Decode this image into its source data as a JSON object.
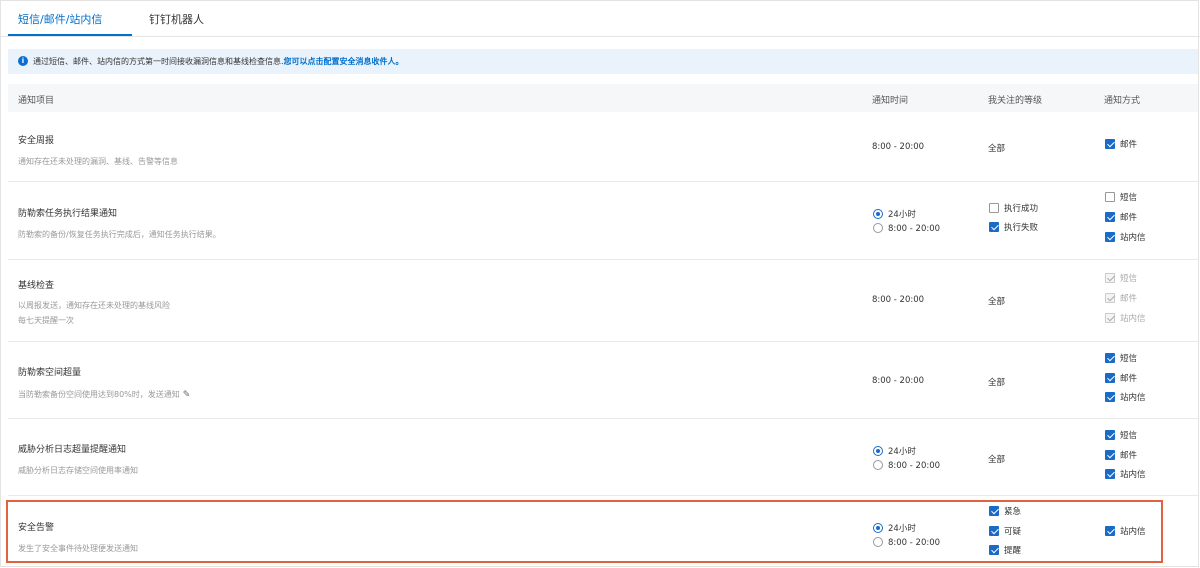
{
  "tabs": [
    {
      "label": "短信/邮件/站内信",
      "active": true
    },
    {
      "label": "钉钉机器人",
      "active": false
    }
  ],
  "info": {
    "icon": "info-icon",
    "text": "通过短信、邮件、站内信的方式第一时间接收漏洞信息和基线检查信息.",
    "link": "您可以点击配置安全消息收件人。"
  },
  "table": {
    "headers": [
      "通知项目",
      "通知时间",
      "我关注的等级",
      "通知方式"
    ],
    "rows": [
      {
        "title": "安全周报",
        "desc": "通知存在还未处理的漏洞、基线、告警等信息",
        "time": "8:00 - 20:00",
        "level": "全部",
        "methods": [
          {
            "label": "邮件",
            "checked": true
          }
        ]
      },
      {
        "title": "防勒索任务执行结果通知",
        "desc": "防勒索的备份/恢复任务执行完成后，通知任务执行结果。",
        "time_options": [
          {
            "label": "24小时",
            "selected": true
          },
          {
            "label": "8:00 - 20:00",
            "selected": false
          }
        ],
        "level_options": [
          {
            "label": "执行成功",
            "checked": false
          },
          {
            "label": "执行失败",
            "checked": true
          }
        ],
        "methods": [
          {
            "label": "短信",
            "checked": false
          },
          {
            "label": "邮件",
            "checked": true
          },
          {
            "label": "站内信",
            "checked": true
          }
        ]
      },
      {
        "title": "基线检查",
        "desc": "以周报发送，通知存在还未处理的基线风险",
        "desc2": "每七天提醒一次",
        "time": "8:00 - 20:00",
        "level": "全部",
        "methods": [
          {
            "label": "短信",
            "checked": true,
            "disabled": true
          },
          {
            "label": "邮件",
            "checked": true,
            "disabled": true
          },
          {
            "label": "站内信",
            "checked": true,
            "disabled": true
          }
        ]
      },
      {
        "title": "防勒索空间超量",
        "desc": "当防勒索备份空间使用达到80%时，发送通知",
        "edit_icon": "edit-icon",
        "time": "8:00 - 20:00",
        "level": "全部",
        "methods": [
          {
            "label": "短信",
            "checked": true
          },
          {
            "label": "邮件",
            "checked": true
          },
          {
            "label": "站内信",
            "checked": true
          }
        ]
      },
      {
        "title": "威胁分析日志超量提醒通知",
        "desc": "威胁分析日志存储空间使用率通知",
        "time_options": [
          {
            "label": "24小时",
            "selected": true
          },
          {
            "label": "8:00 - 20:00",
            "selected": false
          }
        ],
        "level": "全部",
        "methods": [
          {
            "label": "短信",
            "checked": true
          },
          {
            "label": "邮件",
            "checked": true
          },
          {
            "label": "站内信",
            "checked": true
          }
        ]
      },
      {
        "title": "安全告警",
        "desc": "发生了安全事件待处理便发送通知",
        "time_options": [
          {
            "label": "24小时",
            "selected": true
          },
          {
            "label": "8:00 - 20:00",
            "selected": false
          }
        ],
        "level_options": [
          {
            "label": "紧急",
            "checked": true
          },
          {
            "label": "可疑",
            "checked": true
          },
          {
            "label": "提醒",
            "checked": true
          }
        ],
        "methods": [
          {
            "label": "站内信",
            "checked": true
          }
        ]
      }
    ]
  },
  "colors": {
    "accent": "#0070cc",
    "checkbox": "#1a6ac8",
    "highlight": "#e2623f",
    "info_bg": "#eaf3fc"
  }
}
